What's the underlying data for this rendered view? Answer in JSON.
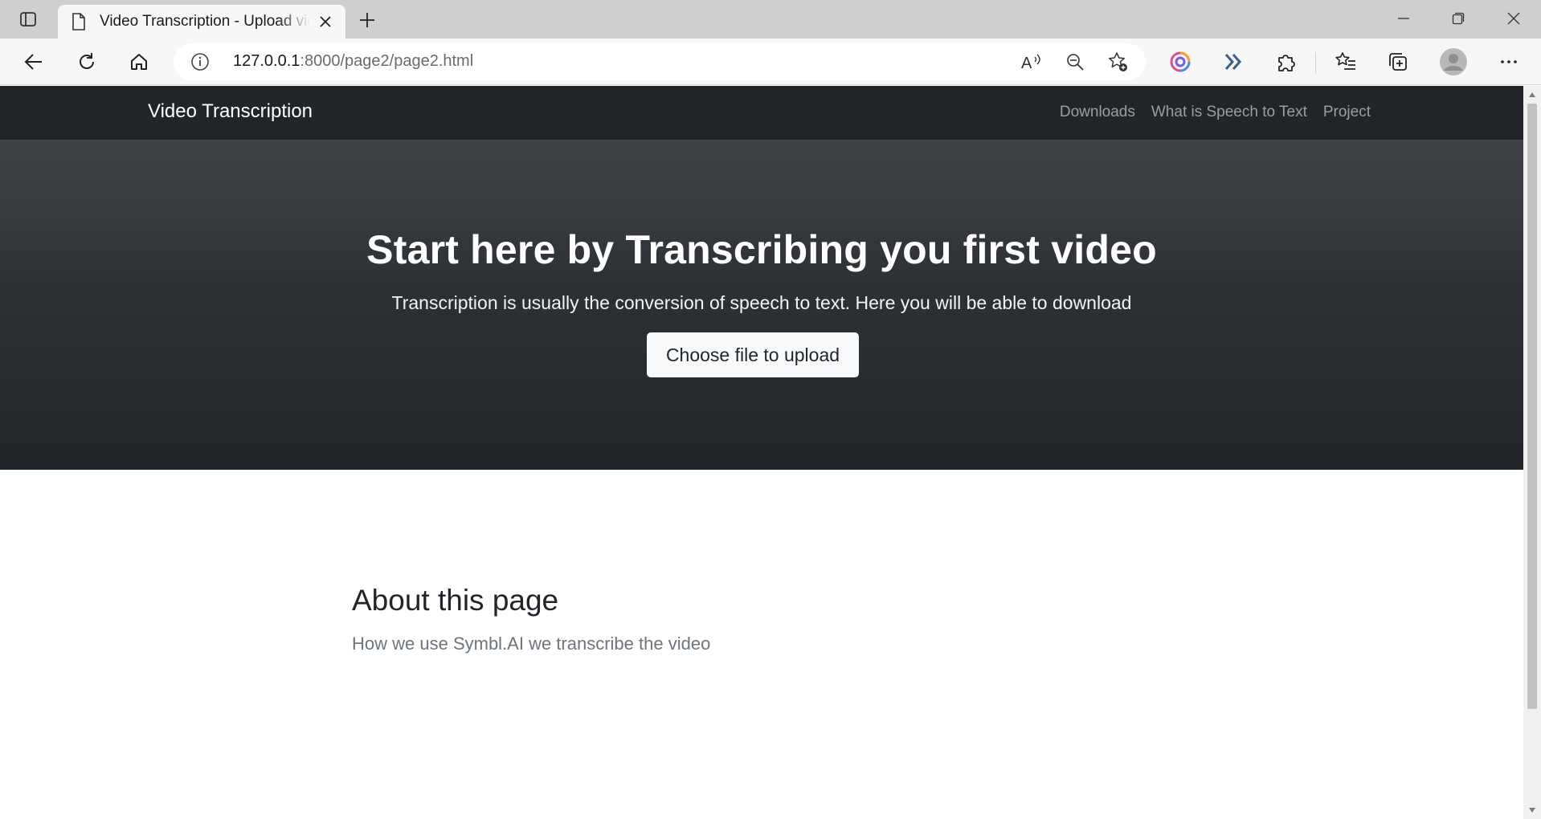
{
  "browser": {
    "tab_title": "Video Transcription - Upload video",
    "url_host": "127.0.0.1",
    "url_rest": ":8000/page2/page2.html"
  },
  "navbar": {
    "brand": "Video Transcription",
    "links": [
      "Downloads",
      "What is Speech to Text",
      "Project"
    ]
  },
  "hero": {
    "title": "Start here by Transcribing you first video",
    "lead": "Transcription is usually the conversion of speech to text. Here you will be able to download",
    "upload_button": "Choose file to upload"
  },
  "about": {
    "title": "About this page",
    "text": "How we use Symbl.AI we transcribe the video"
  },
  "colors": {
    "navbar_bg": "#212529",
    "hero_top": "#3f4347",
    "hero_bottom": "#212529",
    "button_bg": "#f8f9fa",
    "muted_text": "#6c757d"
  },
  "icons": {
    "tab_actions": "tab-actions-icon",
    "page": "page-icon",
    "close_tab": "close-icon",
    "new_tab": "plus-icon",
    "minimize": "minimize-icon",
    "restore": "restore-icon",
    "close_window": "close-window-icon",
    "back": "back-arrow-icon",
    "refresh": "refresh-icon",
    "home": "home-icon",
    "site_info": "info-icon",
    "read_aloud": "read-aloud-icon",
    "zoom_out": "zoom-out-icon",
    "add_favorite": "add-favorite-icon",
    "extension_colorful": "colorful-extension-icon",
    "extension_chevrons": "double-chevron-icon",
    "extensions": "puzzle-icon",
    "favorites": "favorites-icon",
    "collections": "collections-icon",
    "profile": "profile-avatar-icon",
    "menu": "more-icon"
  }
}
